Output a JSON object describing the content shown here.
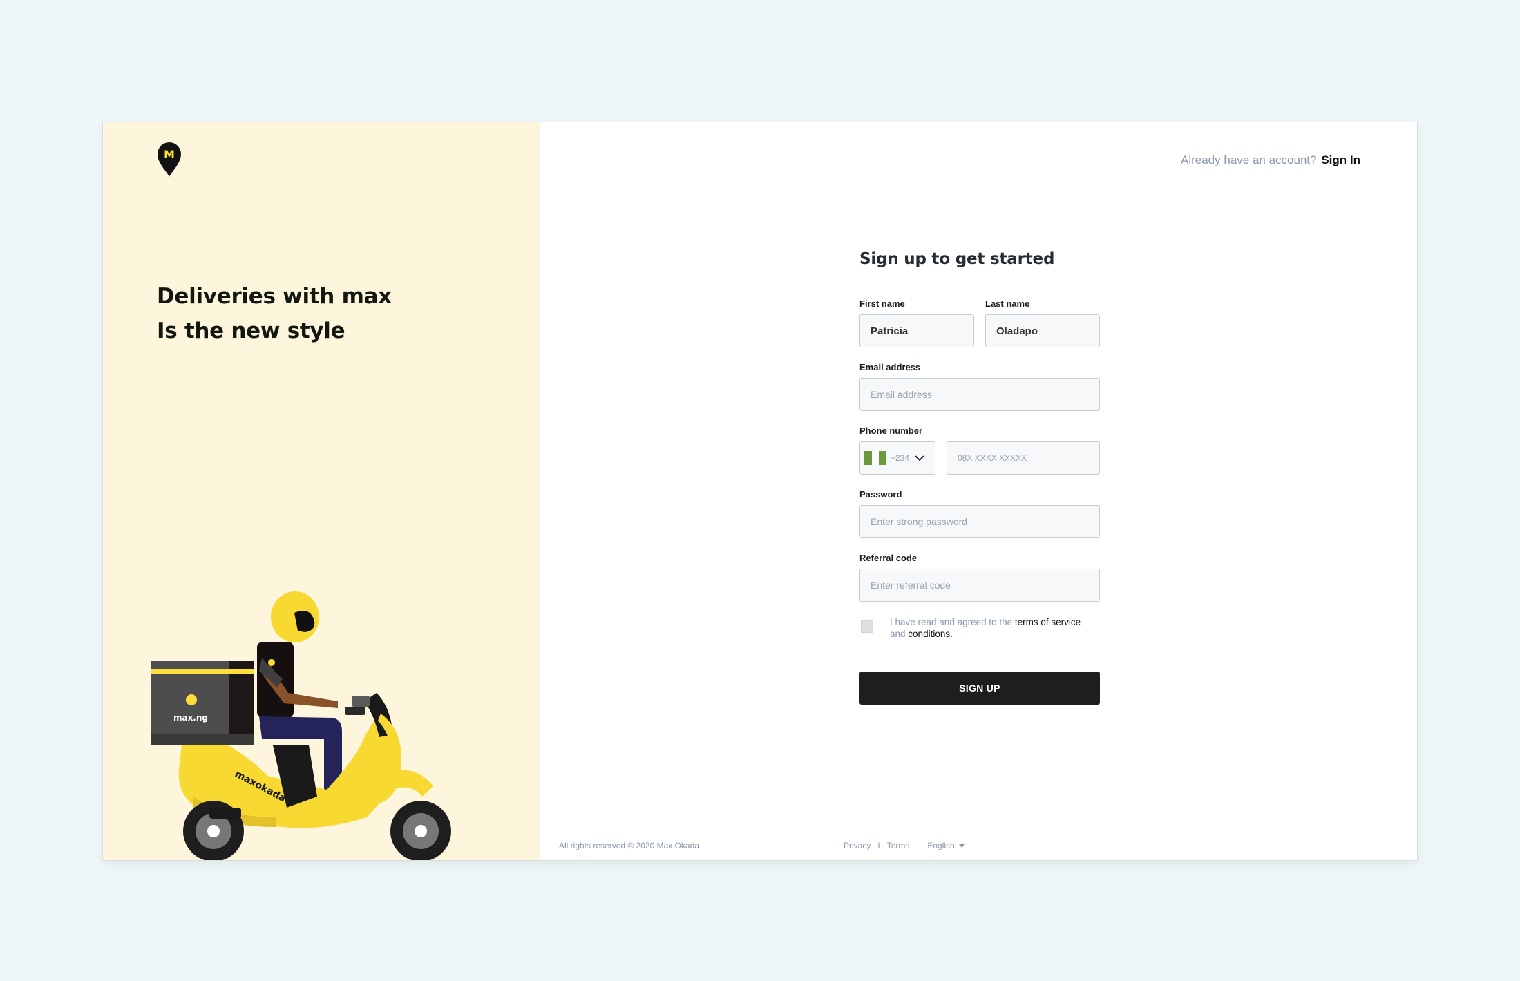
{
  "header": {
    "signin_prompt": "Already have an account?",
    "signin_link": "Sign In"
  },
  "brand": {
    "logo_letter": "M",
    "tagline_line1": "Deliveries with max",
    "tagline_line2": "Is the new style",
    "box_brand": "max.ng",
    "scooter_brand": "maxokada",
    "color_accent": "#fbdd3c",
    "color_panel": "#fdf6dd"
  },
  "form": {
    "title": "Sign up to get started",
    "first_name": {
      "label": "First name",
      "value": "Patricia"
    },
    "last_name": {
      "label": "Last name",
      "value": "Oladapo"
    },
    "email": {
      "label": "Email address",
      "placeholder": "Email address"
    },
    "phone": {
      "label": "Phone number",
      "dial_code": "+234",
      "placeholder": "08X XXXX XXXXX"
    },
    "password": {
      "label": "Password",
      "placeholder": "Enter strong password"
    },
    "referral": {
      "label": "Referral code",
      "placeholder": "Enter referral code"
    },
    "terms": {
      "prefix": "I have read and agreed to the",
      "link1": "terms of service",
      "middle": "and",
      "link2": "conditions."
    },
    "submit_label": "SIGN UP"
  },
  "footer": {
    "copyright": "All rights reserved © 2020 Max.Okada",
    "privacy": "Privacy",
    "separator": "I",
    "terms": "Terms",
    "language": "English"
  }
}
